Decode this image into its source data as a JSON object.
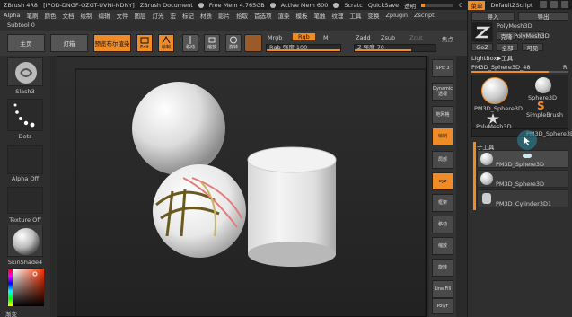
{
  "titlebar": {
    "app": "ZBrush 4R8",
    "id": "[IPOD-DNGF-QZGT-UVNI-NDNY]",
    "doc": "ZBrush Document",
    "free_mem": "Free Mem 4.765GB",
    "active_mem": "Active Mem 600",
    "scratch": "Scratc",
    "quicksave": "QuickSave",
    "transparency": "透明",
    "transparency_value": "0",
    "menus_btn": "菜单",
    "script": "DefaultZScript"
  },
  "menubar": {
    "items": [
      "Alpha",
      "笔刷",
      "颜色",
      "文档",
      "绘制",
      "编辑",
      "文件",
      "图层",
      "灯光",
      "宏",
      "标记",
      "材质",
      "影片",
      "拾取",
      "首选项",
      "渲染",
      "模板",
      "笔触",
      "纹理",
      "工具",
      "变换",
      "Zplugin",
      "Zscript"
    ]
  },
  "subtool_label": "Subtool 0",
  "toolbar": {
    "home": "主页",
    "lightbox": "灯箱",
    "preview_render": "预览布尔渲染",
    "edit": "Edit",
    "draw": "绘制",
    "move": "移动",
    "scale": "缩放",
    "rotate": "旋转",
    "mrgb": "Mrgb",
    "rgb": "Rgb",
    "m": "M",
    "rgb_intensity": "Rgb 强度 100",
    "zadd": "Zadd",
    "zsub": "Zsub",
    "zcut": "Zcut",
    "z_intensity": "Z 强度 70",
    "focal": "焦点"
  },
  "leftshelf": {
    "brush": "Slash3",
    "stroke": "Dots",
    "alpha": "Alpha Off",
    "texture": "Texture Off",
    "material": "SkinShade4",
    "gradient": "渐变"
  },
  "rightshelf": {
    "buttons": [
      "SPix 3",
      "Dynamic 透视",
      "地网格",
      "绘制",
      "局部",
      "xyz",
      "框架",
      "移动",
      "缩放",
      "旋转",
      "Line Fill",
      "PolyF"
    ]
  },
  "rightpanel": {
    "import": "导入",
    "export": "导出",
    "tool_name": "PolyMesh3D",
    "clone": "克隆",
    "polymesh": "PolyMesh3D",
    "goz": "GoZ",
    "all": "全部",
    "visible": "可见",
    "lightbox_tools": "LightBox▶工具",
    "current_tool": "PM3D_Sphere3D_48",
    "r_label": "R",
    "tools": [
      {
        "name": "PM3D_Sphere3D",
        "icon": "sphere-thumb-icon"
      },
      {
        "name": "Sphere3D",
        "icon": "sphere-thumb-icon"
      },
      {
        "name": "SimpleBrush",
        "icon": "simplebrush-icon"
      },
      {
        "name": "PolyMesh3D",
        "icon": "star-icon"
      },
      {
        "name": "PM3D_Sphere3D",
        "icon": "sphere-thumb-icon"
      }
    ],
    "subtool_header": "子工具",
    "subtools": [
      "PM3D_Sphere3D",
      "PM3D_Sphere3D",
      "PM3D_Cylinder3D1"
    ]
  },
  "colors": {
    "accent": "#f08c28",
    "panel": "#2f2f2f",
    "canvas": "#262626"
  }
}
